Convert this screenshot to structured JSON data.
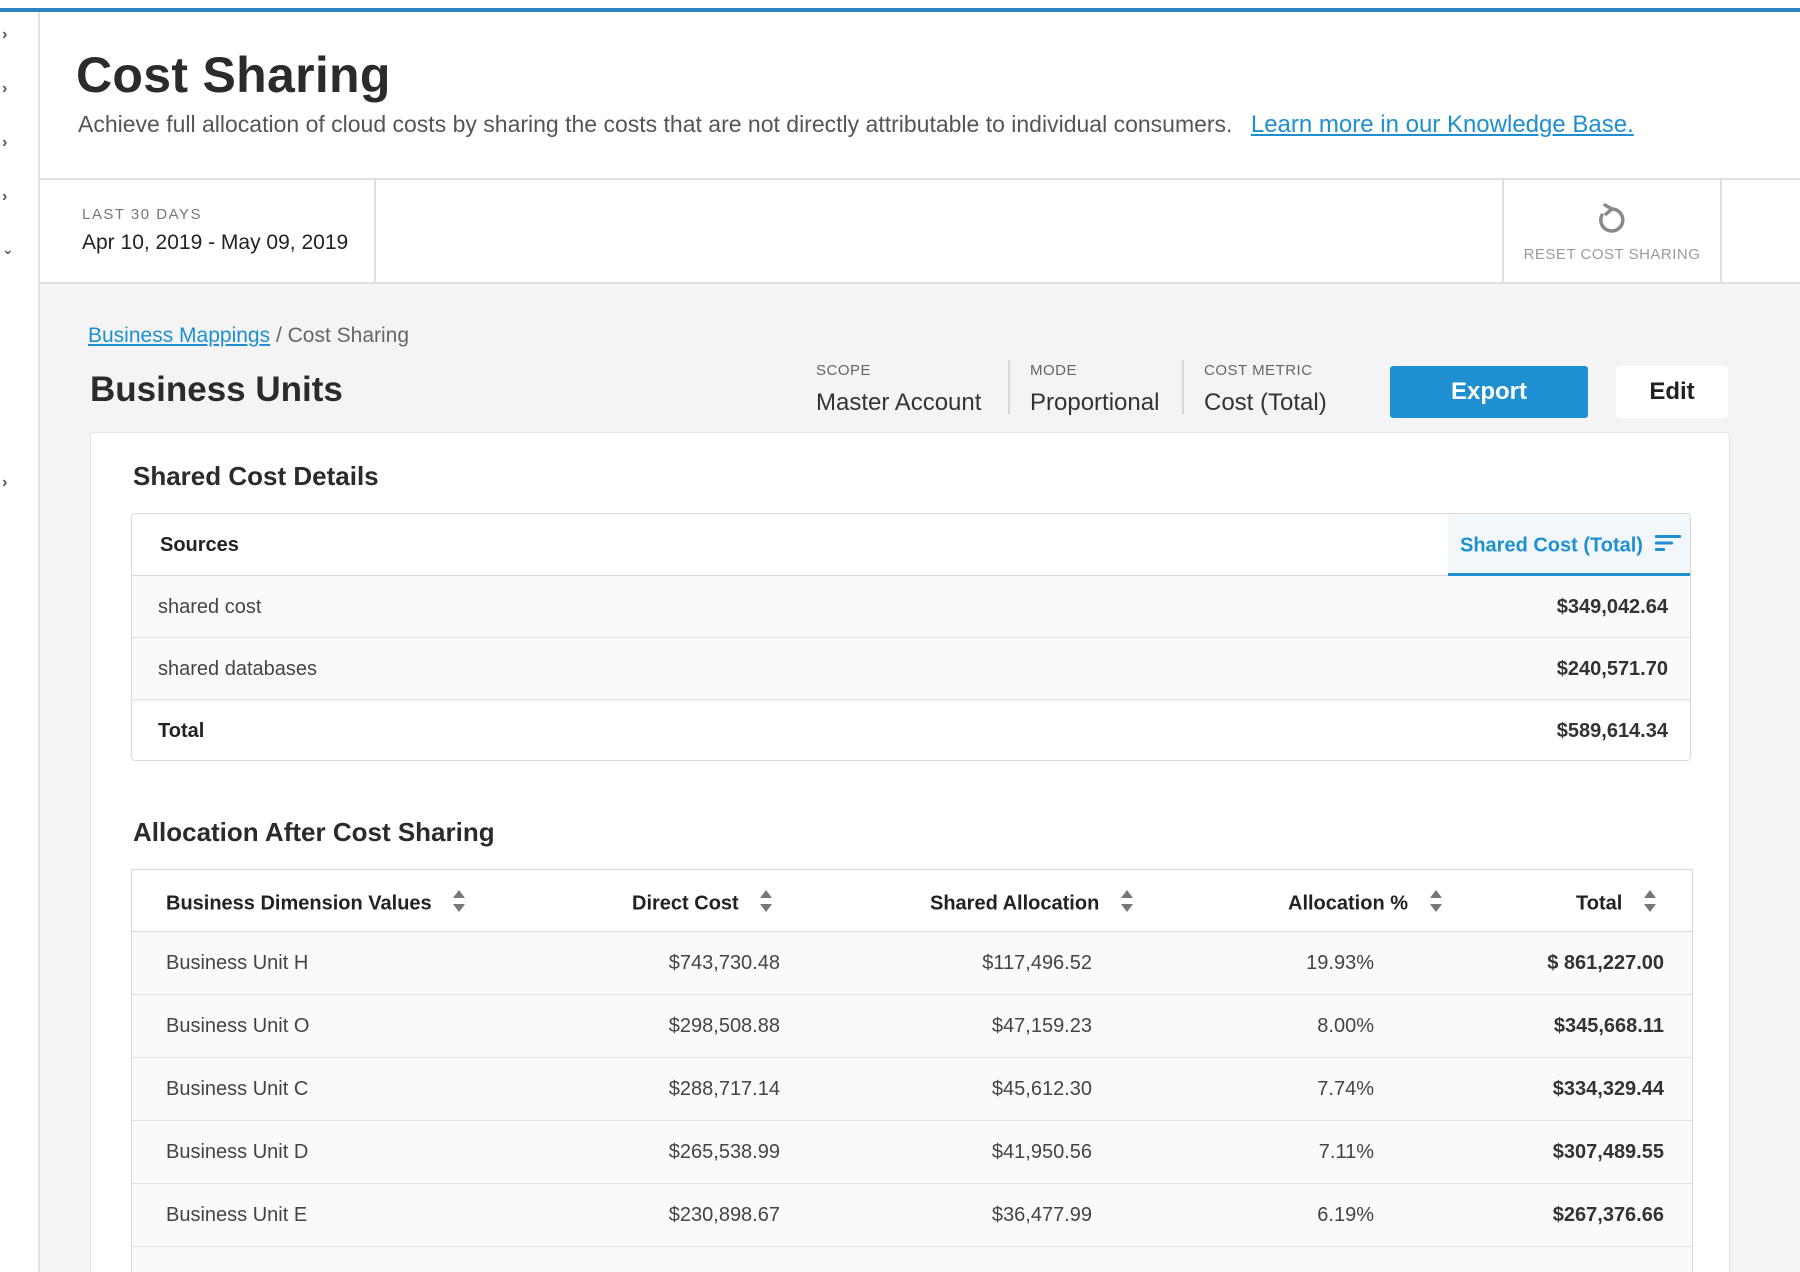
{
  "header": {
    "title": "Cost Sharing",
    "subtitle": "Achieve full allocation of cloud costs by sharing the costs that are not directly attributable to individual consumers.",
    "kb_link": "Learn more in our Knowledge Base."
  },
  "date_range": {
    "label": "LAST 30 DAYS",
    "value": "Apr 10, 2019 - May 09, 2019"
  },
  "reset": {
    "label": "RESET COST SHARING"
  },
  "breadcrumb": {
    "parent": "Business Mappings",
    "separator": " / ",
    "current": "Cost Sharing"
  },
  "section": {
    "title": "Business Units"
  },
  "meta": {
    "scope_label": "SCOPE",
    "scope_value": "Master Account",
    "mode_label": "MODE",
    "mode_value": "Proportional",
    "metric_label": "COST METRIC",
    "metric_value": "Cost (Total)"
  },
  "toolbar": {
    "export_label": "Export",
    "edit_label": "Edit"
  },
  "shared_details": {
    "title": "Shared Cost Details",
    "col_sources": "Sources",
    "col_cost": "Shared Cost (Total)",
    "rows": [
      {
        "source": "shared cost",
        "cost": "$349,042.64"
      },
      {
        "source": "shared databases",
        "cost": "$240,571.70"
      }
    ],
    "total_label": "Total",
    "total_value": "$589,614.34"
  },
  "allocation": {
    "title": "Allocation After Cost Sharing",
    "columns": {
      "dimension": "Business Dimension Values",
      "direct": "Direct Cost",
      "shared": "Shared Allocation",
      "pct": "Allocation %",
      "total": "Total"
    },
    "rows": [
      {
        "name": "Business Unit H",
        "direct": "$743,730.48",
        "shared": "$117,496.52",
        "pct": "19.93%",
        "total": "$ 861,227.00"
      },
      {
        "name": "Business Unit O",
        "direct": "$298,508.88",
        "shared": "$47,159.23",
        "pct": "8.00%",
        "total": "$345,668.11"
      },
      {
        "name": "Business Unit C",
        "direct": "$288,717.14",
        "shared": "$45,612.30",
        "pct": "7.74%",
        "total": "$334,329.44"
      },
      {
        "name": "Business Unit D",
        "direct": "$265,538.99",
        "shared": "$41,950.56",
        "pct": "7.11%",
        "total": "$307,489.55"
      },
      {
        "name": "Business Unit E",
        "direct": "$230,898.67",
        "shared": "$36,477.99",
        "pct": "6.19%",
        "total": "$267,376.66"
      }
    ]
  },
  "colors": {
    "accent": "#1e8fd0",
    "top_bar": "#2e83c0",
    "background": "#f4f4f4"
  },
  "icons": {
    "rail": "chevron-right-icon",
    "reset": "reset-icon",
    "sort_active": "sort-lines-icon",
    "sort": "sort-arrows-icon"
  }
}
